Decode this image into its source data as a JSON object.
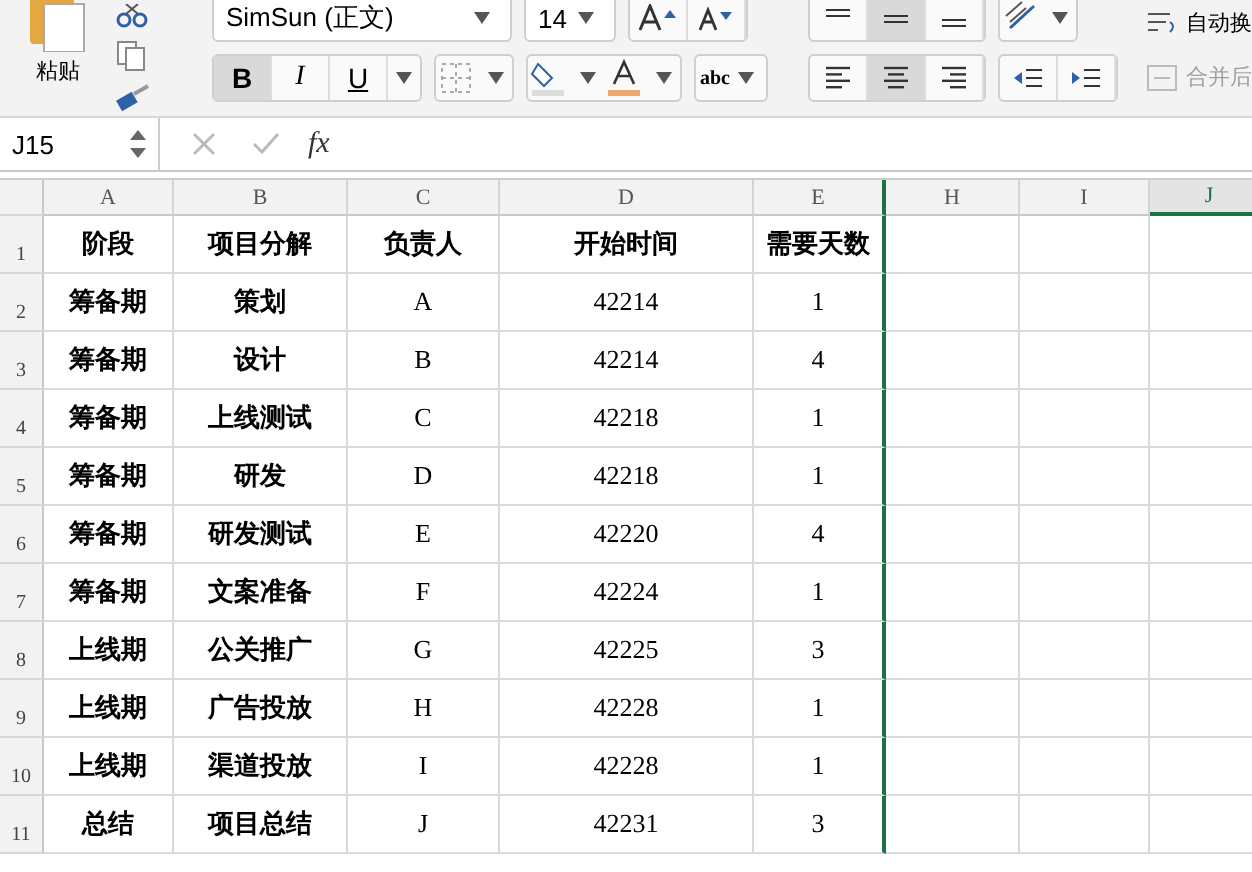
{
  "ribbon": {
    "paste_label": "粘贴",
    "font_name": "SimSun (正文)",
    "font_size": "14",
    "style_buttons": [
      {
        "label": "B",
        "kind": "bold",
        "selected": true
      },
      {
        "label": "I",
        "kind": "italic",
        "selected": false
      },
      {
        "label": "U",
        "kind": "underline",
        "selected": false
      }
    ],
    "align_buttons": [
      {
        "kind": "left",
        "selected": false
      },
      {
        "kind": "center",
        "selected": true
      },
      {
        "kind": "right",
        "selected": false
      }
    ],
    "text_effect_label": "abc",
    "wrap_text": {
      "label": "自动换",
      "disabled": false
    },
    "merge": {
      "label": "合并后",
      "disabled": true
    }
  },
  "formula_bar": {
    "name_box": "J15",
    "fx": "fx"
  },
  "columns": [
    {
      "label": "A",
      "selected": false
    },
    {
      "label": "B",
      "selected": false
    },
    {
      "label": "C",
      "selected": false
    },
    {
      "label": "D",
      "selected": false
    },
    {
      "label": "E",
      "selected": false
    },
    {
      "label": "H",
      "selected": false
    },
    {
      "label": "I",
      "selected": false
    },
    {
      "label": "J",
      "selected": true
    }
  ],
  "rows": [
    {
      "number": "1",
      "cells": [
        "阶段",
        "项目分解",
        "负责人",
        "开始时间",
        "需要天数"
      ]
    },
    {
      "number": "2",
      "cells": [
        "筹备期",
        "策划",
        "A",
        "42214",
        "1"
      ]
    },
    {
      "number": "3",
      "cells": [
        "筹备期",
        "设计",
        "B",
        "42214",
        "4"
      ]
    },
    {
      "number": "4",
      "cells": [
        "筹备期",
        "上线测试",
        "C",
        "42218",
        "1"
      ]
    },
    {
      "number": "5",
      "cells": [
        "筹备期",
        "研发",
        "D",
        "42218",
        "1"
      ]
    },
    {
      "number": "6",
      "cells": [
        "筹备期",
        "研发测试",
        "E",
        "42220",
        "4"
      ]
    },
    {
      "number": "7",
      "cells": [
        "筹备期",
        "文案准备",
        "F",
        "42224",
        "1"
      ]
    },
    {
      "number": "8",
      "cells": [
        "上线期",
        "公关推广",
        "G",
        "42225",
        "3"
      ]
    },
    {
      "number": "9",
      "cells": [
        "上线期",
        "广告投放",
        "H",
        "42228",
        "1"
      ]
    },
    {
      "number": "10",
      "cells": [
        "上线期",
        "渠道投放",
        "I",
        "42228",
        "1"
      ]
    },
    {
      "number": "11",
      "cells": [
        "总结",
        "项目总结",
        "J",
        "42231",
        "3"
      ]
    }
  ]
}
